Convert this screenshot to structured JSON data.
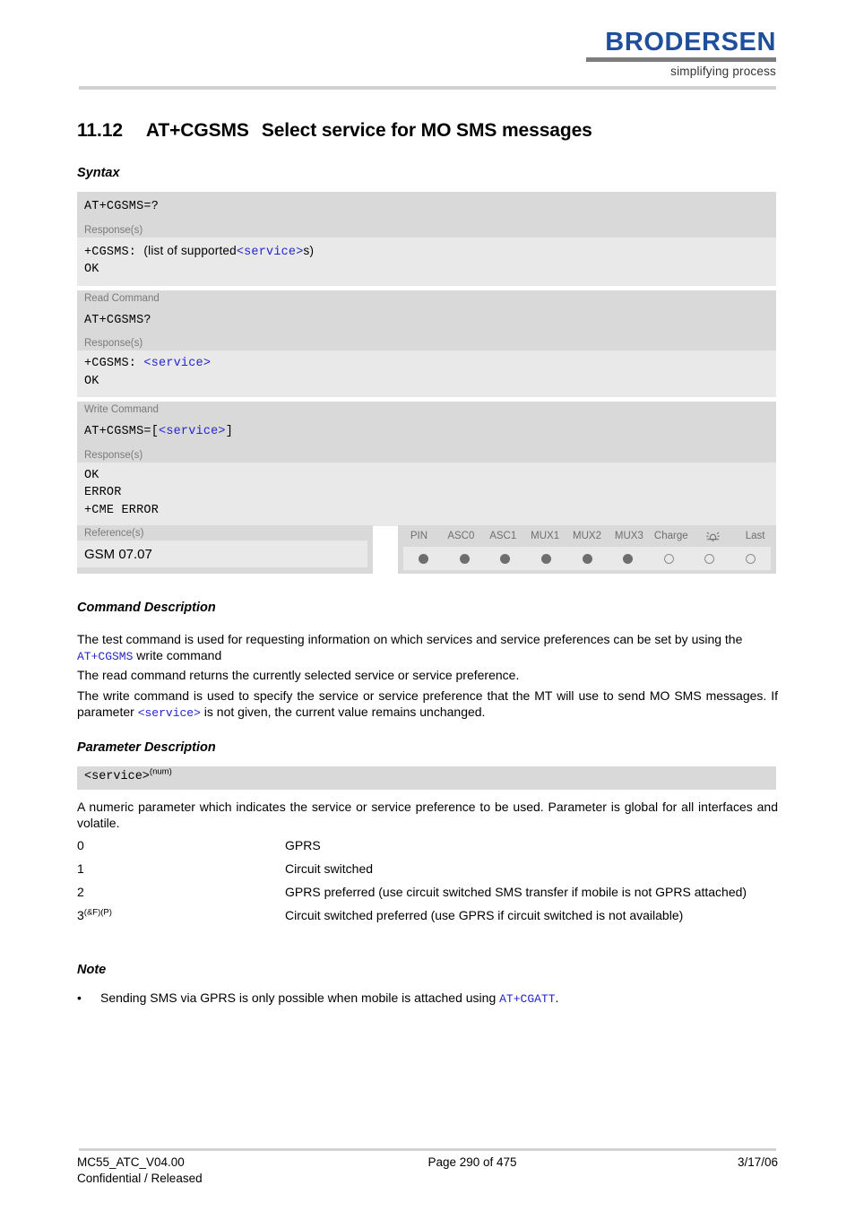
{
  "header": {
    "logo_word": "BRODERSEN",
    "logo_tagline": "simplifying process"
  },
  "title": {
    "number": "11.12",
    "command": "AT+CGSMS",
    "text": "Select service for MO SMS messages"
  },
  "headings": {
    "syntax": "Syntax",
    "command_description": "Command Description",
    "parameter_description": "Parameter Description",
    "note": "Note"
  },
  "syntax": {
    "test_command_line": "AT+CGSMS=?",
    "test_response_label": "Response(s)",
    "test_response_prefix": "+CGSMS:",
    "test_response_mid": "(list of supported",
    "test_response_param": "<service>",
    "test_response_suffix": "s)",
    "test_response_ok": "OK",
    "read_label": "Read Command",
    "read_command_line": "AT+CGSMS?",
    "read_response_label": "Response(s)",
    "read_response_prefix": "+CGSMS:",
    "read_response_param": "<service>",
    "read_response_ok": "OK",
    "write_label": "Write Command",
    "write_command_prefix": "AT+CGSMS=[",
    "write_command_param": "<service>",
    "write_command_suffix": "]",
    "write_response_label": "Response(s)",
    "write_response_ok": "OK",
    "write_response_error": "ERROR",
    "write_response_cme": "+CME ERROR"
  },
  "reference": {
    "label": "Reference(s)",
    "value": "GSM 07.07"
  },
  "attributes": {
    "columns": [
      "PIN",
      "ASC0",
      "ASC1",
      "MUX1",
      "MUX2",
      "MUX3",
      "Charge",
      "asleep-icon",
      "Last"
    ],
    "states": [
      "filled",
      "filled",
      "filled",
      "filled",
      "filled",
      "filled",
      "hollow",
      "hollow",
      "hollow"
    ]
  },
  "command_description": {
    "p1_a": "The test command is used for requesting information on which services and service preferences can be set by using the ",
    "p1_cmd": "AT+CGSMS",
    "p1_b": " write command",
    "p2": "The read command returns the currently selected service or service preference.",
    "p3_a": "The write command is used to specify the service or service preference that the MT will use to send MO SMS messages. If parameter ",
    "p3_param": "<service>",
    "p3_b": " is not given, the current value remains unchanged."
  },
  "parameter_description": {
    "param_name": "<service>",
    "param_sup": "(num)",
    "intro": "A numeric parameter which indicates the service or service preference to be used. Parameter is global for all interfaces and volatile.",
    "values": [
      {
        "key": "0",
        "key_sup": "",
        "desc": "GPRS"
      },
      {
        "key": "1",
        "key_sup": "",
        "desc": "Circuit switched"
      },
      {
        "key": "2",
        "key_sup": "",
        "desc": "GPRS preferred (use circuit switched SMS transfer if mobile is not GPRS attached)"
      },
      {
        "key": "3",
        "key_sup": "(&F)(P)",
        "desc": "Circuit switched preferred (use GPRS if circuit switched is not available)"
      }
    ]
  },
  "note": {
    "bullet": "•",
    "text_a": "Sending SMS via GPRS is only possible when mobile is attached using ",
    "text_cmd": "AT+CGATT",
    "text_b": "."
  },
  "footer": {
    "doc_id": "MC55_ATC_V04.00",
    "classification": "Confidential / Released",
    "page": "Page 290 of 475",
    "date": "3/17/06"
  },
  "colors": {
    "brand_blue": "#1f4e9c",
    "param_blue": "#2424cc",
    "band_gray": "#d9d9d9",
    "panel_gray": "#e9e9e9"
  }
}
